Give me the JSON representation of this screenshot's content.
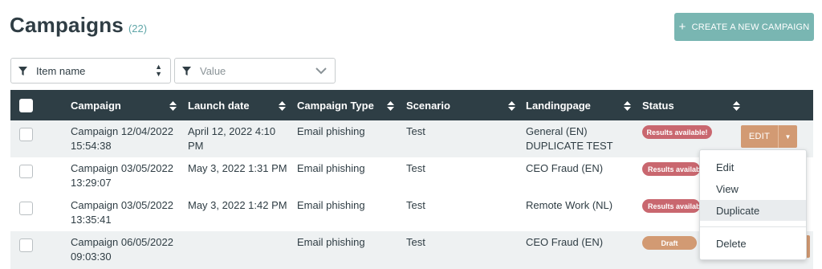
{
  "header": {
    "title": "Campaigns",
    "count": "(22)",
    "create_button": "CREATE A NEW CAMPAIGN"
  },
  "filters": {
    "item": "Item name",
    "value_placeholder": "Value"
  },
  "table": {
    "columns": [
      "Campaign",
      "Launch date",
      "Campaign Type",
      "Scenario",
      "Landingpage",
      "Status"
    ],
    "rows": [
      {
        "campaign": [
          "Campaign 12/04/2022",
          "15:54:38"
        ],
        "launch": [
          "April 12, 2022 4:10",
          "PM"
        ],
        "type": "Email phishing",
        "scenario": "Test",
        "landing": [
          "General (EN)",
          "DUPLICATE TEST"
        ],
        "status": "Results available!"
      },
      {
        "campaign": [
          "Campaign 03/05/2022",
          "13:29:07"
        ],
        "launch": [
          "May 3, 2022 1:31 PM",
          ""
        ],
        "type": "Email phishing",
        "scenario": "Test",
        "landing": [
          "CEO Fraud (EN)",
          ""
        ],
        "status": "Results available!"
      },
      {
        "campaign": [
          "Campaign 03/05/2022",
          "13:35:41"
        ],
        "launch": [
          "May 3, 2022 1:42 PM",
          ""
        ],
        "type": "Email phishing",
        "scenario": "Test",
        "landing": [
          "Remote Work (NL)",
          ""
        ],
        "status": "Results available!"
      },
      {
        "campaign": [
          "Campaign 06/05/2022",
          "09:03:30"
        ],
        "launch": [
          "",
          ""
        ],
        "type": "Email phishing",
        "scenario": "Test",
        "landing": [
          "CEO Fraud (EN)",
          ""
        ],
        "status": "Draft"
      }
    ]
  },
  "actions": {
    "edit": "EDIT"
  },
  "dropdown": {
    "items": [
      "Edit",
      "View",
      "Duplicate",
      "Delete"
    ]
  },
  "colors": {
    "header_bg": "#2e3e45",
    "accent_teal": "#79b6b2",
    "results_badge": "#c9676f",
    "draft_badge": "#d29a73"
  }
}
